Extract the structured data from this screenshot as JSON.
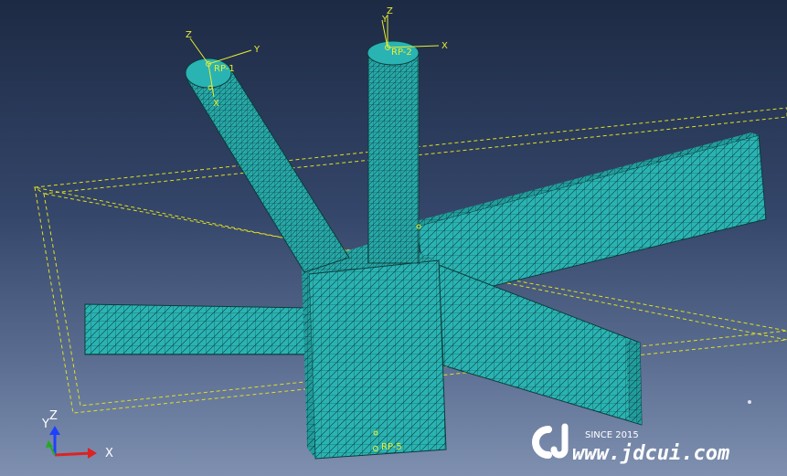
{
  "viewport": {
    "background_top": "#1d2a44",
    "background_bottom": "#7f90b0",
    "mesh_color": "#2ab3b3",
    "mesh_line_color": "#0c3c3c",
    "ref_plane_color": "#e0e020"
  },
  "reference_points": [
    {
      "label": "RP-1",
      "axes": [
        "Z",
        "Y",
        "X"
      ]
    },
    {
      "label": "RP-2",
      "axes": [
        "Z",
        "Y",
        "X"
      ]
    },
    {
      "label": "RP-5"
    }
  ],
  "triad": {
    "labels": [
      "Z",
      "Y",
      "X"
    ],
    "colors": [
      "#2040ff",
      "#22aa22",
      "#dd2222"
    ]
  },
  "watermark": {
    "logo": "CJ",
    "since": "SINCE 2015",
    "url": "www.jdcui.com"
  }
}
